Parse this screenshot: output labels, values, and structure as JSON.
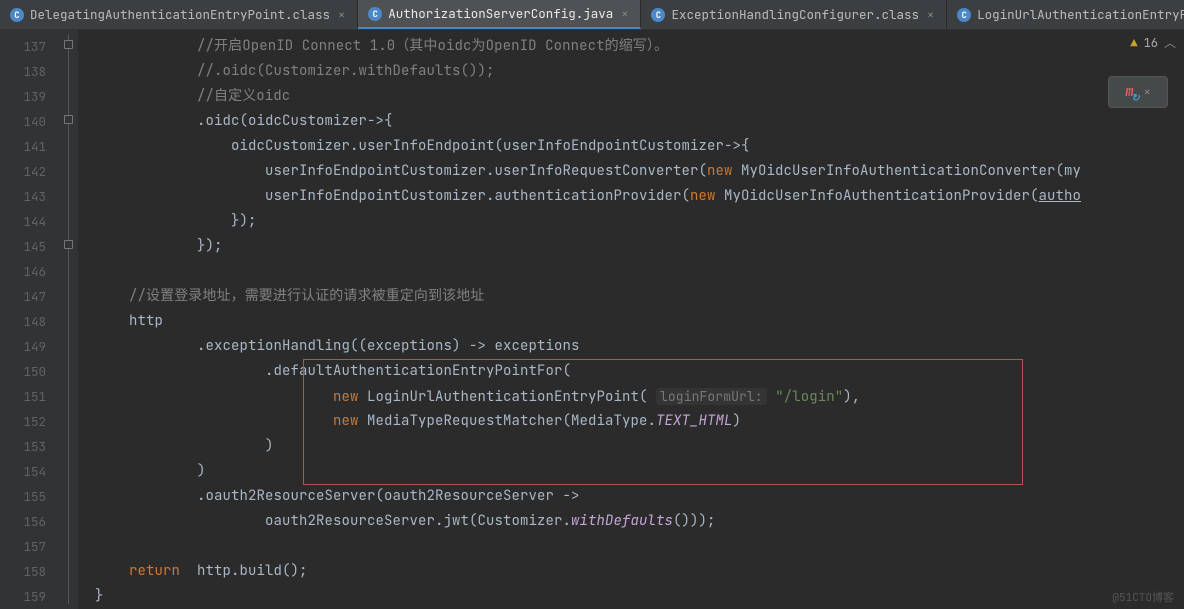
{
  "tabs": [
    {
      "label": "DelegatingAuthenticationEntryPoint.class",
      "active": false
    },
    {
      "label": "AuthorizationServerConfig.java",
      "active": true
    },
    {
      "label": "ExceptionHandlingConfigurer.class",
      "active": false
    },
    {
      "label": "LoginUrlAuthenticationEntryPoint.class",
      "active": false
    }
  ],
  "warnings": {
    "count": "16"
  },
  "watermark": "@51CTO博客",
  "gutter": {
    "start": 137,
    "end": 159
  },
  "code": {
    "l137": "//开启OpenID Connect 1.0（其中oidc为OpenID Connect的缩写）。",
    "l138": "//.oidc(Customizer.withDefaults());",
    "l139": "//自定义oidc",
    "l140": ".oidc(oidcCustomizer->{",
    "l141": "    oidcCustomizer.userInfoEndpoint(userInfoEndpointCustomizer->{",
    "l142_a": "userInfoEndpointCustomizer.userInfoRequestConverter(",
    "l142_b": "new",
    "l142_c": " MyOidcUserInfoAuthenticationConverter(my",
    "l143_a": "userInfoEndpointCustomizer.authenticationProvider(",
    "l143_b": "new",
    "l143_c": " MyOidcUserInfoAuthenticationProvider(",
    "l143_d": "autho",
    "l144": "});",
    "l145": "});",
    "l147": "//设置登录地址，需要进行认证的请求被重定向到该地址",
    "l148": "http",
    "l149": ".exceptionHandling((exceptions) -> exceptions",
    "l150": ".defaultAuthenticationEntryPointFor(",
    "l151_a": "new",
    "l151_b": " LoginUrlAuthenticationEntryPoint(",
    "l151_hint": "loginFormUrl:",
    "l151_c": " \"/login\"",
    "l151_d": "),",
    "l152_a": "new",
    "l152_b": " MediaTypeRequestMatcher(MediaType.",
    "l152_c": "TEXT_HTML",
    "l152_d": ")",
    "l153": ")",
    "l154": ")",
    "l155": ".oauth2ResourceServer(oauth2ResourceServer ->",
    "l156_a": "oauth2ResourceServer.jwt(Customizer.",
    "l156_b": "withDefaults",
    "l156_c": "()));",
    "l158_a": "return",
    "l158_b": "  http.build();",
    "l159": "}"
  }
}
